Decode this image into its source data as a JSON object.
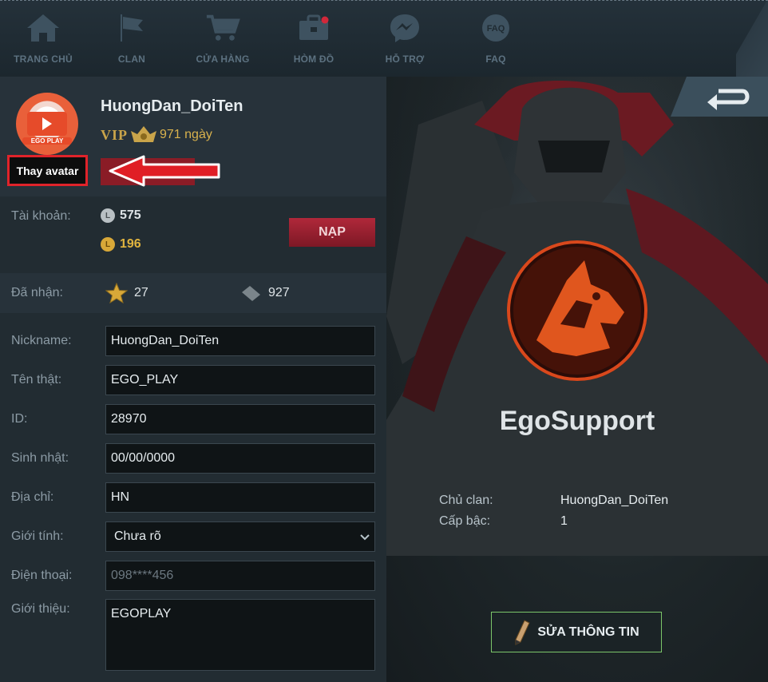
{
  "nav": {
    "items": [
      {
        "label": "TRANG CHỦ",
        "icon": "home-icon"
      },
      {
        "label": "CLAN",
        "icon": "flag-icon"
      },
      {
        "label": "CỬA HÀNG",
        "icon": "cart-icon"
      },
      {
        "label": "HÒM ĐỒ",
        "icon": "chest-icon"
      },
      {
        "label": "HỖ TRỢ",
        "icon": "messenger-icon"
      },
      {
        "label": "FAQ",
        "icon": "faq-icon"
      }
    ],
    "faq_icon_text": "FAQ"
  },
  "profile": {
    "username": "HuongDan_DoiTen",
    "vip_label": "VIP",
    "vip_days": "971 ngày",
    "change_avatar_label": "Thay avatar",
    "avatar_badge_text": "EGO PLAY"
  },
  "account": {
    "label": "Tài khoản:",
    "silver_amount": "575",
    "gold_amount": "196",
    "topup_label": "NẠP"
  },
  "received": {
    "label": "Đã nhận:",
    "stars": "27",
    "tickets": "927"
  },
  "form": {
    "nickname": {
      "label": "Nickname:",
      "value": "HuongDan_DoiTen"
    },
    "real_name": {
      "label": "Tên thật:",
      "value": "EGO_PLAY"
    },
    "id": {
      "label": "ID:",
      "value": "28970"
    },
    "birthday": {
      "label": "Sinh nhật:",
      "value": "00/00/0000"
    },
    "address": {
      "label": "Địa chỉ:",
      "value": "HN"
    },
    "gender": {
      "label": "Giới tính:",
      "value": "Chưa rõ"
    },
    "phone": {
      "label": "Điện thoại:",
      "placeholder": "098****456"
    },
    "intro": {
      "label": "Giới thiệu:",
      "value": "EGOPLAY"
    }
  },
  "clan": {
    "name": "EgoSupport",
    "owner_label": "Chủ clan:",
    "owner_value": "HuongDan_DoiTen",
    "rank_label": "Cấp bậc:",
    "rank_value": "1",
    "edit_label": "SỬA THÔNG TIN"
  },
  "colors": {
    "accent_red": "#b0283a",
    "highlight_border": "#e0232a",
    "edit_border": "#7cc66a",
    "gold": "#d9b24d"
  }
}
